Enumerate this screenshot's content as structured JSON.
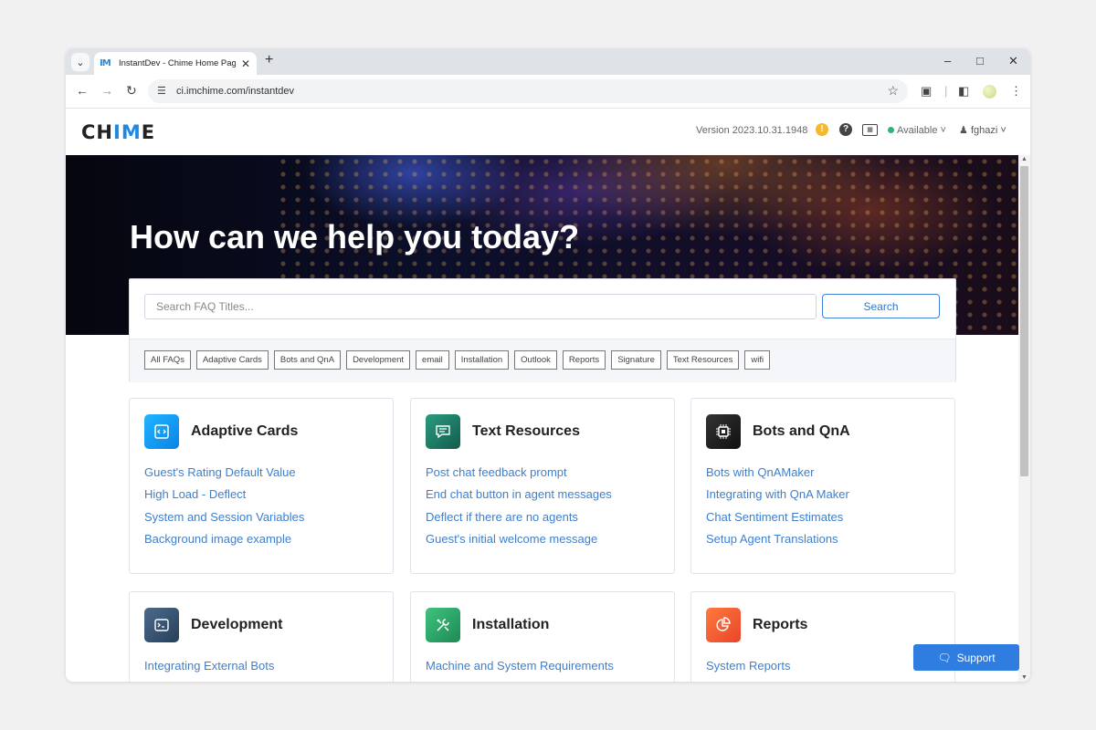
{
  "browser": {
    "tab_title": "InstantDev - Chime Home Page",
    "favicon_text": "IM",
    "url": "ci.imchime.com/instantdev"
  },
  "header": {
    "logo_left": "CH",
    "logo_accent": "IM",
    "logo_right": "E",
    "version": "Version 2023.10.31.1948",
    "status": "Available",
    "username": "fghazi"
  },
  "hero": {
    "title": "How can we help you today?"
  },
  "search": {
    "placeholder": "Search FAQ Titles...",
    "button_label": "Search"
  },
  "tags": [
    "All FAQs",
    "Adaptive Cards",
    "Bots and QnA",
    "Development",
    "email",
    "Installation",
    "Outlook",
    "Reports",
    "Signature",
    "Text Resources",
    "wifi"
  ],
  "categories": [
    {
      "title": "Adaptive Cards",
      "icon": "code-icon",
      "color": "#1a9bf0",
      "links": [
        "Guest's Rating Default Value",
        "High Load - Deflect",
        "System and Session Variables",
        "Background image example"
      ]
    },
    {
      "title": "Text Resources",
      "icon": "chat-bubble-icon",
      "color": "#1b7a64",
      "links": [
        "Post chat feedback prompt",
        "End chat button in agent messages",
        "Deflect if there are no agents",
        "Guest's initial welcome message"
      ]
    },
    {
      "title": "Bots and QnA",
      "icon": "chip-icon",
      "color": "#1f1f1f",
      "links": [
        "Bots with QnAMaker",
        "Integrating with QnA Maker",
        "Chat Sentiment Estimates",
        "Setup Agent Translations"
      ]
    },
    {
      "title": "Development",
      "icon": "terminal-icon",
      "color": "#3a5673",
      "links": [
        "Integrating External Bots"
      ]
    },
    {
      "title": "Installation",
      "icon": "tools-icon",
      "color": "#2aa86a",
      "links": [
        "Machine and System Requirements"
      ]
    },
    {
      "title": "Reports",
      "icon": "pie-chart-icon",
      "color": "#f25a2c",
      "links": [
        "System Reports"
      ]
    }
  ],
  "support": {
    "label": "Support"
  }
}
